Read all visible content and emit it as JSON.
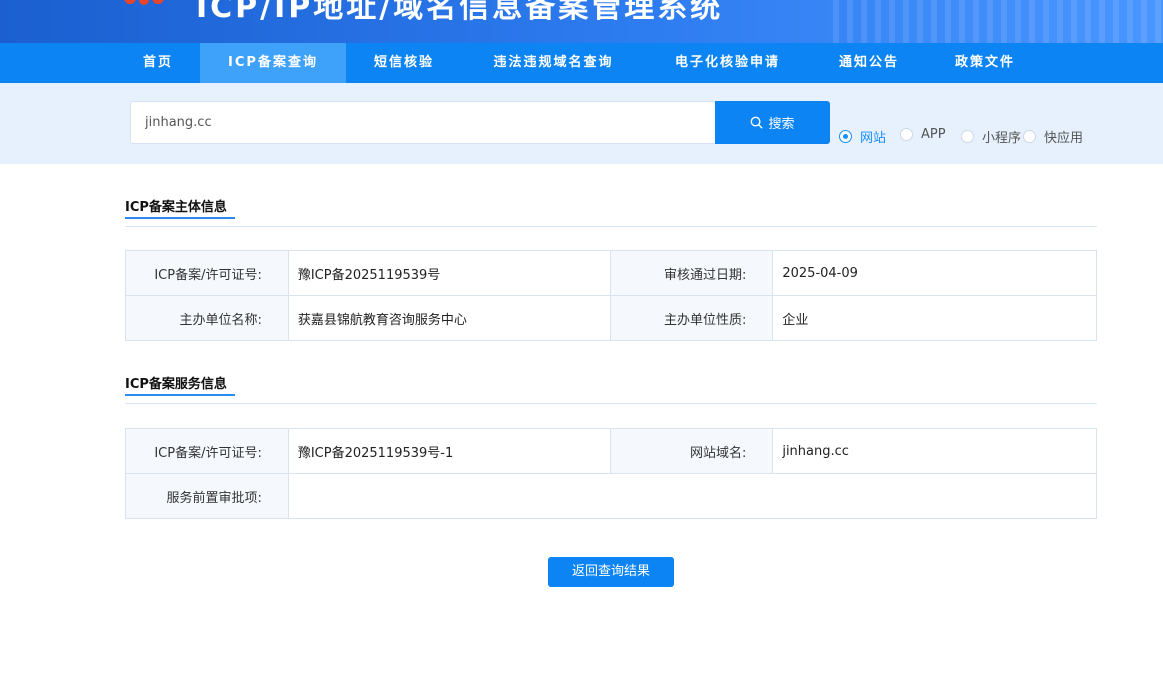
{
  "header": {
    "title": "ICP/IP地址/域名信息备案管理系统"
  },
  "nav": {
    "items": [
      {
        "label": "首页",
        "active": false
      },
      {
        "label": "ICP备案查询",
        "active": true
      },
      {
        "label": "短信核验",
        "active": false
      },
      {
        "label": "违法违规域名查询",
        "active": false
      },
      {
        "label": "电子化核验申请",
        "active": false
      },
      {
        "label": "通知公告",
        "active": false
      },
      {
        "label": "政策文件",
        "active": false
      }
    ]
  },
  "search": {
    "value": "jinhang.cc",
    "button_label": "搜索",
    "options": [
      {
        "label": "网站",
        "checked": true
      },
      {
        "label": "APP",
        "checked": false
      },
      {
        "label": "小程序",
        "checked": false
      },
      {
        "label": "快应用",
        "checked": false
      }
    ]
  },
  "subject_info": {
    "title": "ICP备案主体信息",
    "rows": [
      {
        "k1": "ICP备案/许可证号:",
        "v1": "豫ICP备2025119539号",
        "k2": "审核通过日期:",
        "v2": "2025-04-09"
      },
      {
        "k1": "主办单位名称:",
        "v1": "获嘉县锦航教育咨询服务中心",
        "k2": "主办单位性质:",
        "v2": "企业"
      }
    ]
  },
  "service_info": {
    "title": "ICP备案服务信息",
    "license_label": "ICP备案/许可证号:",
    "license_value": "豫ICP备2025119539号-1",
    "domain_label": "网站域名:",
    "domain_value": "jinhang.cc",
    "approval_label": "服务前置审批项:",
    "approval_value": ""
  },
  "back_button_label": "返回查询结果",
  "colors": {
    "primary": "#0d84f3",
    "nav_active": "#3ea2fb",
    "search_band": "#e6f1fd"
  }
}
